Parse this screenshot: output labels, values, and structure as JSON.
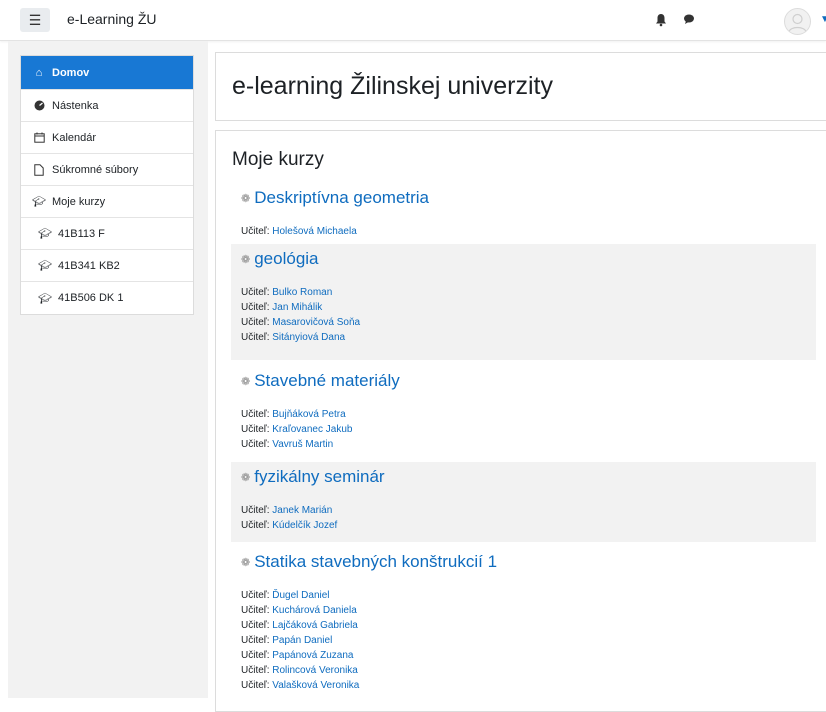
{
  "navbar": {
    "menu_icon": "hamburger-icon",
    "site_name": "e-Learning ŽU",
    "icons": [
      "bell-icon",
      "chat-icon",
      "avatar"
    ]
  },
  "sidebar": {
    "items": [
      {
        "label": "Domov",
        "icon": "home-icon",
        "active": true
      },
      {
        "label": "Nástenka",
        "icon": "dashboard-icon"
      },
      {
        "label": "Kalendár",
        "icon": "calendar-icon"
      },
      {
        "label": "Súkromné súbory",
        "icon": "file-icon"
      },
      {
        "label": "Moje kurzy",
        "icon": "graduation-cap-icon"
      },
      {
        "label": "41B113 F",
        "icon": "graduation-cap-icon"
      },
      {
        "label": "41B341 KB2",
        "icon": "graduation-cap-icon"
      },
      {
        "label": "41B506 DK 1",
        "icon": "graduation-cap-icon"
      }
    ]
  },
  "main": {
    "page_title": "e-learning Žilinskej univerzity",
    "section_title": "Moje kurzy",
    "teacher_label": "Učiteľ: ",
    "courses": [
      {
        "title": "Deskriptívna geometria",
        "teachers": [
          "Holešová Michaela"
        ]
      },
      {
        "title": "geológia",
        "teachers": [
          "Bulko Roman",
          "Jan Mihálik",
          "Masarovičová Soňa",
          "Sitányiová Dana"
        ]
      },
      {
        "title": "Stavebné materiály",
        "teachers": [
          "Bujňáková Petra",
          "Kraľovanec Jakub",
          "Vavruš Martin"
        ]
      },
      {
        "title": "fyzikálny seminár",
        "teachers": [
          "Janek Marián",
          "Kúdelčík Jozef"
        ]
      },
      {
        "title": "Statika stavebných konštrukcií 1",
        "teachers": [
          "Ďugel Daniel",
          "Kuchárová Daniela",
          "Lajčáková Gabriela",
          "Papán Daniel",
          "Papánová Zuzana",
          "Rolincová Veronika",
          "Valašková Veronika"
        ]
      }
    ]
  },
  "colors": {
    "accent": "#1878d4",
    "link": "#0f6cbf",
    "shaded_row": "#f2f2f2"
  }
}
